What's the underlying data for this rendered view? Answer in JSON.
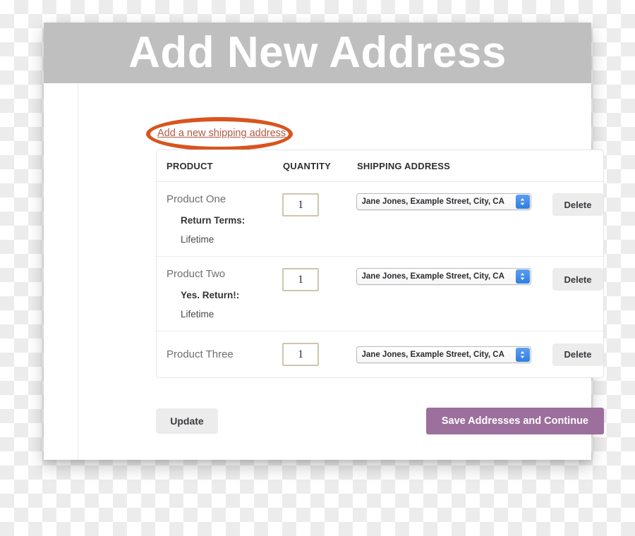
{
  "banner": {
    "title": "Add New Address"
  },
  "annotation": {
    "shape": "ellipse-highlight",
    "color": "#d9541e"
  },
  "add_address_link": {
    "label": "Add a new shipping address",
    "color": "#b05a48"
  },
  "table": {
    "headers": {
      "product": "PRODUCT",
      "quantity": "QUANTITY",
      "shipping_address": "SHIPPING ADDRESS",
      "action": ""
    },
    "rows": [
      {
        "product": "Product One",
        "terms_label": "Return Terms:",
        "terms_value": "Lifetime",
        "quantity": "1",
        "address": "Jane Jones, Example Street, City, CA",
        "delete_label": "Delete"
      },
      {
        "product": "Product Two",
        "terms_label": "Yes. Return!:",
        "terms_value": "Lifetime",
        "quantity": "1",
        "address": "Jane Jones, Example Street, City, CA",
        "delete_label": "Delete"
      },
      {
        "product": "Product Three",
        "terms_label": "",
        "terms_value": "",
        "quantity": "1",
        "address": "Jane Jones, Example Street, City, CA",
        "delete_label": "Delete"
      }
    ]
  },
  "footer": {
    "update_label": "Update",
    "save_label": "Save Addresses and Continue",
    "save_color": "#9c6f9c"
  }
}
